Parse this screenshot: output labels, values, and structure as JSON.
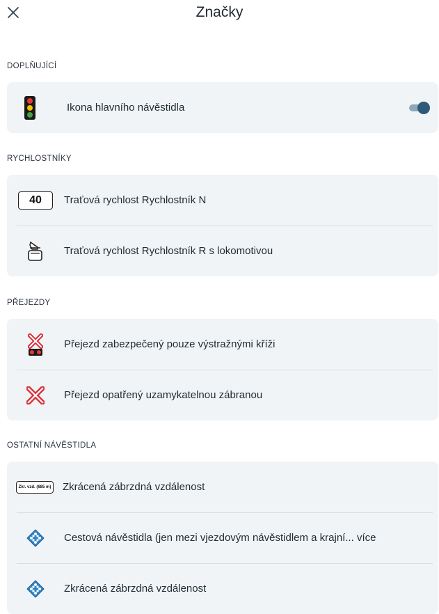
{
  "header": {
    "title": "Značky"
  },
  "sections": [
    {
      "title": "DOPLŇUJÍCÍ",
      "items": [
        {
          "label": "Ikona hlavního návěstidla",
          "toggle_on": true
        }
      ]
    },
    {
      "title": "RYCHLOSTNÍKY",
      "items": [
        {
          "label": "Traťová rychlost Rychlostník N",
          "sign_text": "40"
        },
        {
          "label": "Traťová rychlost Rychlostník R s lokomotivou"
        }
      ]
    },
    {
      "title": "PŘEJEZDY",
      "items": [
        {
          "label": "Přejezd zabezpečený pouze výstražnými kříži"
        },
        {
          "label": "Přejezd opatřený uzamykatelnou zábranou"
        }
      ]
    },
    {
      "title": "OSTATNÍ NÁVĚSTIDLA",
      "items": [
        {
          "label": "Zkrácená zábrzdná vzdálenost",
          "sign_text": "Zkr. vzd. (685 m)"
        },
        {
          "label": "Cestová návěstidla (jen mezi vjezdovým návěstidlem a krajní... více"
        },
        {
          "label": "Zkrácená zábrzdná vzdálenost"
        }
      ]
    }
  ],
  "colors": {
    "toggle_track": "#8ea7b8",
    "toggle_knob": "#2f5978",
    "crossing_red": "#d8323c",
    "diamond_blue": "#2f86c7"
  }
}
